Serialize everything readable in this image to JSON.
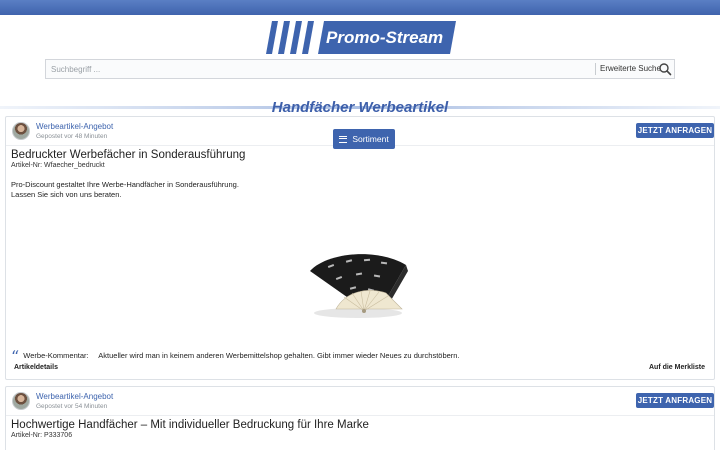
{
  "header": {
    "logo_text": "Promo-Stream",
    "brand_color": "#3e64ae"
  },
  "search": {
    "placeholder": "Suchbegriff ...",
    "value": "",
    "advanced_label": "Erweiterte Suche"
  },
  "hero": {
    "title": "Handfächer Werbeartikel"
  },
  "sortiment_button": {
    "label": "Sortiment",
    "icon": "menu-icon"
  },
  "posts": [
    {
      "author": "Werbeartikel-Angebot",
      "posted": "Gepostet vor 48 Minuten",
      "cta": "JETZT ANFRAGEN",
      "title": "Bedruckter Werbefächer in Sonderausführung",
      "article_no": "Artikel-Nr: Wfaecher_bedruckt",
      "description_line1": "Pro-Discount gestaltet Ihre Werbe-Handfächer in Sonderausführung.",
      "description_line2": "Lassen Sie sich von uns beraten.",
      "comment_label": "Werbe-Kommentar:",
      "comment_text": "Aktueller wird man in keinem anderen Werbemittelshop gehalten. Gibt immer wieder Neues zu durchstöbern.",
      "details_label": "Artikeldetails",
      "wishlist_label": "Auf die Merkliste"
    },
    {
      "author": "Werbeartikel-Angebot",
      "posted": "Gepostet vor 54 Minuten",
      "cta": "JETZT ANFRAGEN",
      "title": "Hochwertige Handfächer – Mit individueller Bedruckung für Ihre Marke",
      "article_no": "Artikel-Nr: P333706"
    }
  ]
}
